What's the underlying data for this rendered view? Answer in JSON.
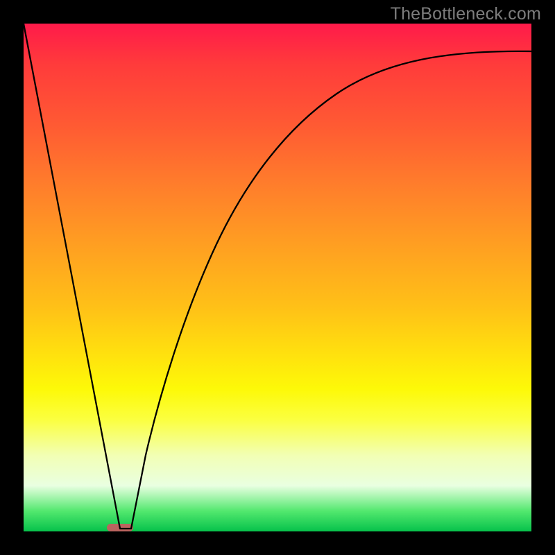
{
  "watermark": "TheBottleneck.com",
  "chart_data": {
    "type": "line",
    "title": "",
    "xlabel": "",
    "ylabel": "",
    "xlim": [
      0,
      100
    ],
    "ylim": [
      0,
      100
    ],
    "grid": false,
    "legend": false,
    "annotations": [],
    "series": [
      {
        "name": "bottleneck-curve",
        "x": [
          0,
          5,
          10,
          15,
          18,
          20,
          22,
          25,
          28,
          32,
          36,
          40,
          45,
          50,
          55,
          60,
          65,
          70,
          75,
          80,
          85,
          90,
          95,
          100
        ],
        "values": [
          100,
          72,
          44,
          16,
          0,
          0,
          12,
          28,
          42,
          55,
          65,
          72,
          78,
          82.5,
          85.5,
          87.8,
          89.5,
          90.8,
          91.8,
          92.6,
          93.2,
          93.7,
          94.1,
          94.4
        ]
      }
    ],
    "marker": {
      "name": "optimal-zone",
      "x_range": [
        16.5,
        21.5
      ],
      "y": 0,
      "color": "#bb645f"
    },
    "background_gradient": {
      "top": "#ff1a4a",
      "bottom": "#06c24b"
    }
  }
}
